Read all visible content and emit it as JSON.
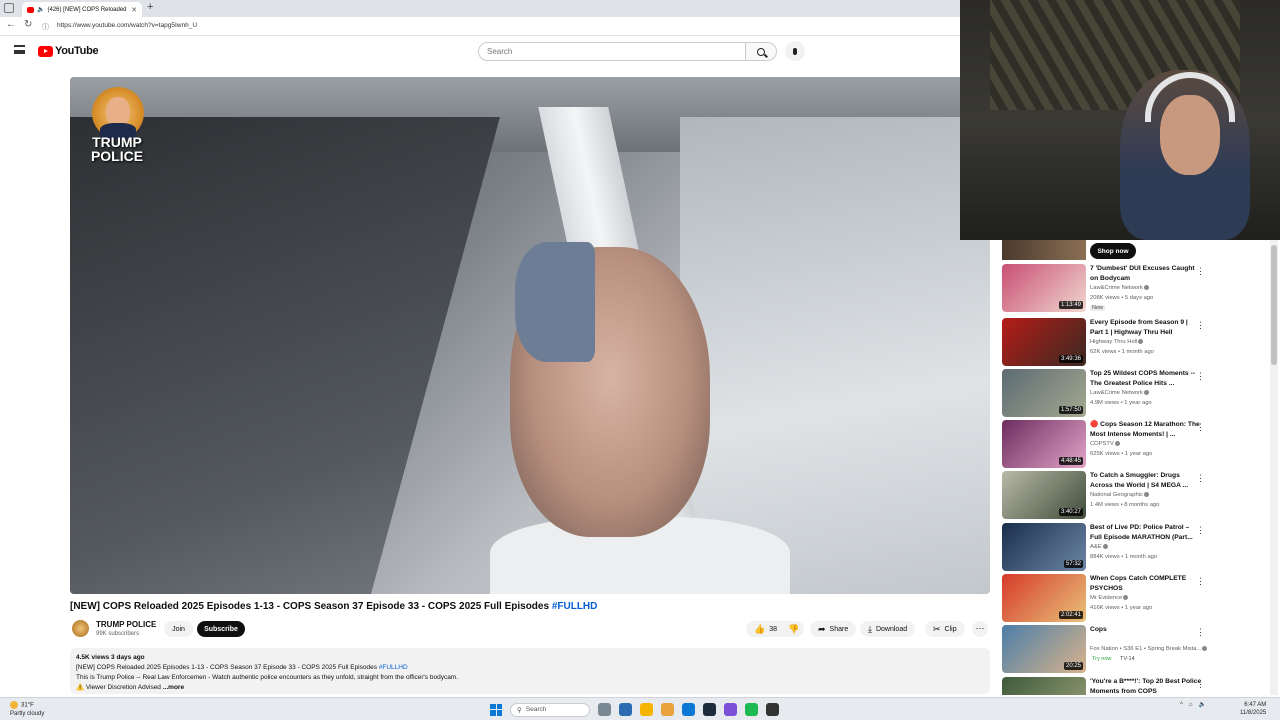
{
  "browser": {
    "tab_title": "(426) [NEW] COPS Reloaded",
    "url": "https://www.youtube.com/watch?v=tapg5Iwnh_U",
    "new_tab": "+",
    "close": "✕"
  },
  "header": {
    "logo_text": "YouTube",
    "search_placeholder": "Search"
  },
  "player": {
    "badge_text": "TRUMP POLICE"
  },
  "video": {
    "title": "[NEW] COPS Reloaded 2025 Episodes 1-13 - COPS Season 37 Episode 33 - COPS 2025 Full Episodes ",
    "title_tag": "#FULLHD",
    "channel": "TRUMP POLICE",
    "subscribers": "99K subscribers",
    "join_label": "Join",
    "subscribe_label": "Subscribe",
    "likes": "38",
    "share_label": "Share",
    "download_label": "Download",
    "clip_label": "Clip"
  },
  "description": {
    "stats": "4.5K views  3 days ago",
    "line1": "[NEW] COPS Reloaded 2025 Episodes 1-13 - COPS Season 37 Episode 33 - COPS 2025 Full Episodes ",
    "line1_tag": "#FULLHD",
    "line2": "This is Trump Police -- Real Law Enforcemen - Watch authentic police encounters as they unfold, straight from the officer's bodycam.",
    "line3": "⚠️ Viewer Discretion Advised",
    "more": "...more"
  },
  "sidebar": {
    "shop_now": "Shop now",
    "items": [
      {
        "title": "7 'Dumbest' DUI Excuses Caught on Bodycam",
        "channel": "Law&Crime Network",
        "meta": "208K views • 5 days ago",
        "badge": "New",
        "duration": "1:13:49",
        "c1": "#c94f73",
        "c2": "#f0d7cf"
      },
      {
        "title": "Every Episode from Season 9 | Part 1 | Highway Thru Hell",
        "channel": "Highway Thru Hell",
        "meta": "62K views • 1 month ago",
        "duration": "3:49:36",
        "c1": "#b61c18",
        "c2": "#3a2a22"
      },
      {
        "title": "Top 25 Wildest COPS Moments -- The Greatest Police Hits ...",
        "channel": "Law&Crime Network",
        "meta": "4.9M views • 1 year ago",
        "duration": "1:57:50",
        "c1": "#5d6b73",
        "c2": "#a3a98f"
      },
      {
        "title": "🔴 Cops Season 12 Marathon: The Most Intense Moments! | ...",
        "channel": "COPSTV",
        "meta": "625K views • 1 year ago",
        "duration": "4:48:45",
        "c1": "#6b2d5f",
        "c2": "#e3a4c8"
      },
      {
        "title": "To Catch a Smuggler: Drugs Across the World | S4 MEGA ...",
        "channel": "National Geographic",
        "meta": "1.4M views • 8 months ago",
        "duration": "3:40:27",
        "c1": "#b9b9a8",
        "c2": "#3f4d3a"
      },
      {
        "title": "Best of Live PD: Police Patrol – Full Episode MARATHON (Part...",
        "channel": "A&E",
        "meta": "884K views • 1 month ago",
        "duration": "57:32",
        "c1": "#1a2f4d",
        "c2": "#6d86a6"
      },
      {
        "title": "When Cops Catch COMPLETE PSYCHOS",
        "channel": "Mr Evidence",
        "meta": "416K views • 1 year ago",
        "duration": "2:02:41",
        "c1": "#d63a2a",
        "c2": "#e8c27a"
      },
      {
        "title": "Cops",
        "channel": "Fox Nation • S36 E1 • Spring Break Mista...",
        "meta": "",
        "badge_green": "Try now",
        "rating": "TV-14",
        "duration": "20:25",
        "c1": "#4b7fa8",
        "c2": "#d9b38c"
      },
      {
        "title": "'You're a B****!': Top 20 Best Police Moments from COPS",
        "channel": "",
        "meta": "",
        "duration": "",
        "c1": "#3f5a3a",
        "c2": "#9aa27a"
      }
    ]
  },
  "taskbar": {
    "temp": "31°F",
    "weather": "Partly cloudy",
    "search_label": "Search",
    "time": "6:47 AM",
    "date": "11/8/2025",
    "apps": [
      "#7a8894",
      "#2b6cb0",
      "#f4b400",
      "#e8a33c",
      "#0a78d4",
      "#1e2b3a",
      "#7b4fd6",
      "#1db954",
      "#333333"
    ]
  }
}
